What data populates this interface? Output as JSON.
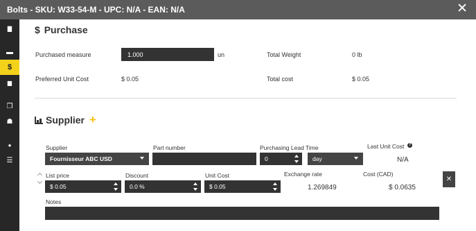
{
  "window": {
    "title": "Bolts - SKU: W33-54-M - UPC: N/A - EAN: N/A",
    "close_glyph": "✕"
  },
  "sidebar": {
    "items": [
      {
        "icon": "document-icon",
        "glyph": "▇"
      },
      {
        "icon": "card-icon",
        "glyph": "▬"
      },
      {
        "icon": "dollar-icon",
        "glyph": "$",
        "active": true
      },
      {
        "icon": "calculator-icon",
        "glyph": "▆"
      },
      {
        "icon": "copy-icon",
        "glyph": "❐"
      },
      {
        "icon": "cubes-icon",
        "glyph": "☗"
      },
      {
        "icon": "chat-icon",
        "glyph": "●"
      },
      {
        "icon": "list-icon",
        "glyph": "☰"
      }
    ]
  },
  "purchase": {
    "heading_symbol": "$",
    "heading": "Purchase",
    "purchased_measure_label": "Purchased measure",
    "purchased_measure_value": "1.000",
    "purchased_measure_unit": "un",
    "total_weight_label": "Total Weight",
    "total_weight_value": "0 lb",
    "preferred_unit_cost_label": "Preferred Unit Cost",
    "preferred_unit_cost_value": "$ 0.05",
    "total_cost_label": "Total cost",
    "total_cost_value": "$ 0.05"
  },
  "supplier": {
    "heading": "Supplier",
    "add_glyph": "+",
    "supplier_label": "Supplier",
    "supplier_value": "Fournisseur ABC USD",
    "part_number_label": "Part number",
    "part_number_value": "",
    "lead_time_label": "Purchasing Lead Time",
    "lead_time_value": "0",
    "lead_time_unit": "day",
    "last_unit_cost_label": "Last Unit Cost",
    "last_unit_cost_help": "?",
    "last_unit_cost_value": "N/A",
    "list_price_label": "List price",
    "list_price_value": "$ 0.05",
    "discount_label": "Discount",
    "discount_value": "0.0 %",
    "unit_cost_label": "Unit Cost",
    "unit_cost_value": "$ 0.05",
    "exchange_rate_label": "Exchange rate",
    "exchange_rate_value": "1.269849",
    "cost_cad_label": "Cost (CAD)",
    "cost_cad_value": "$ 0.0635",
    "notes_label": "Notes",
    "notes_value": "",
    "remove_glyph": "✕"
  }
}
